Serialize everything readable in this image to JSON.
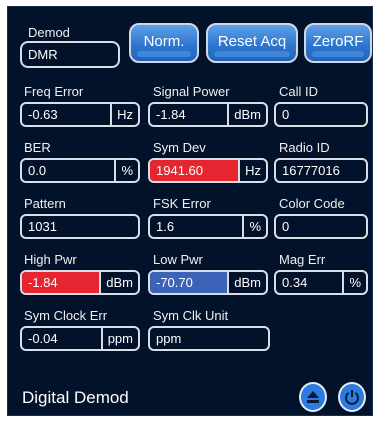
{
  "demod": {
    "label": "Demod",
    "value": "DMR"
  },
  "buttons": {
    "norm": "Norm.",
    "reset_acq": "Reset Acq",
    "zero_rf": "ZeroRF"
  },
  "measurements": {
    "freq_error": {
      "label": "Freq Error",
      "value": "-0.63",
      "unit": "Hz"
    },
    "signal_power": {
      "label": "Signal Power",
      "value": "-1.84",
      "unit": "dBm"
    },
    "call_id": {
      "label": "Call ID",
      "value": "0"
    },
    "ber": {
      "label": "BER",
      "value": "0.0",
      "unit": "%"
    },
    "sym_dev": {
      "label": "Sym Dev",
      "value": "1941.60",
      "unit": "Hz"
    },
    "radio_id": {
      "label": "Radio ID",
      "value": "16777016"
    },
    "pattern": {
      "label": "Pattern",
      "value": "1031"
    },
    "fsk_error": {
      "label": "FSK Error",
      "value": "1.6",
      "unit": "%"
    },
    "color_code": {
      "label": "Color Code",
      "value": "0"
    },
    "high_pwr": {
      "label": "High Pwr",
      "value": "-1.84",
      "unit": "dBm"
    },
    "low_pwr": {
      "label": "Low Pwr",
      "value": "-70.70",
      "unit": "dBm"
    },
    "mag_err": {
      "label": "Mag Err",
      "value": "0.34",
      "unit": "%"
    },
    "sym_clock_err": {
      "label": "Sym Clock Err",
      "value": "-0.04",
      "unit": "ppm"
    },
    "sym_clk_unit": {
      "label": "Sym Clk Unit",
      "value": "ppm"
    }
  },
  "footer": {
    "title": "Digital Demod",
    "left_icon": "eject-icon",
    "right_icon": "power-icon"
  },
  "colors": {
    "background": "#03122b",
    "alarm_red": "#e5252f",
    "highlight_blue": "#3b63b8",
    "button_blue": "#2f76cf"
  }
}
